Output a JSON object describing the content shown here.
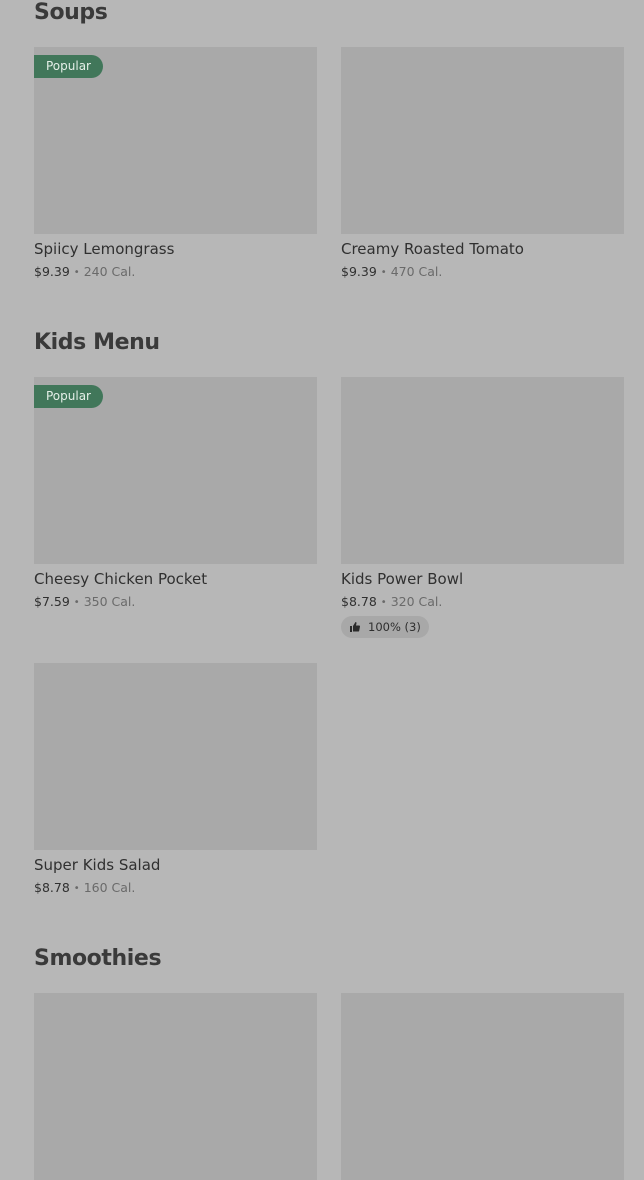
{
  "sections": [
    {
      "title": "Soups",
      "items": [
        {
          "name": "Spiicy Lemongrass",
          "price": "$9.39",
          "separator": "•",
          "calories": "240 Cal.",
          "badge": "Popular"
        },
        {
          "name": "Creamy Roasted Tomato",
          "price": "$9.39",
          "separator": "•",
          "calories": "470 Cal."
        }
      ]
    },
    {
      "title": "Kids Menu",
      "items": [
        {
          "name": "Cheesy Chicken Pocket",
          "price": "$7.59",
          "separator": "•",
          "calories": "350 Cal.",
          "badge": "Popular"
        },
        {
          "name": "Kids Power Bowl",
          "price": "$8.78",
          "separator": "•",
          "calories": "320 Cal.",
          "rating": "100% (3)",
          "rating_icon": "thumbs-up-icon"
        },
        {
          "name": "Super Kids Salad",
          "price": "$8.78",
          "separator": "•",
          "calories": "160 Cal."
        }
      ]
    },
    {
      "title": "Smoothies",
      "items": [
        {},
        {}
      ]
    }
  ],
  "colors": {
    "background": "#b7b7b7",
    "image_placeholder": "#a9a9a9",
    "popular_badge": "#41775a"
  }
}
